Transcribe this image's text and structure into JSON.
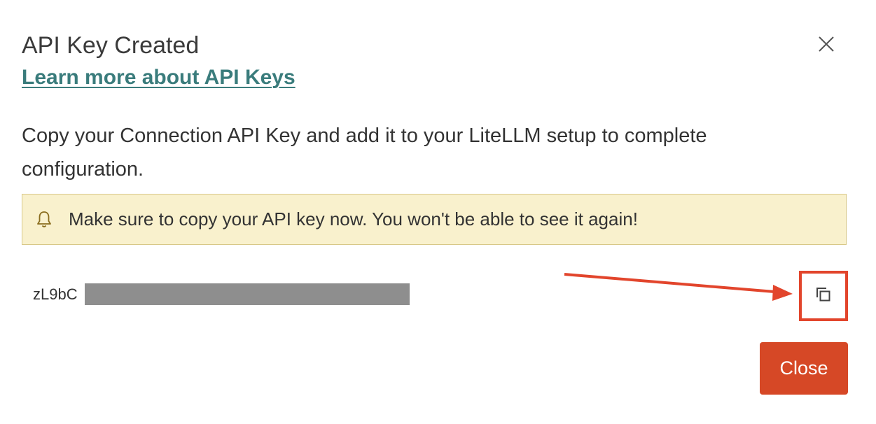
{
  "dialog": {
    "title": "API Key Created",
    "learn_more_link": "Learn more about API Keys",
    "description": "Copy your Connection API Key and add it to your LiteLLM setup to complete configuration.",
    "warning": {
      "icon": "bell-icon",
      "text": "Make sure to copy your API key now. You won't be able to see it again!"
    },
    "api_key": {
      "visible_prefix": "zL9bC",
      "copy_icon": "copy-icon"
    },
    "close_button_label": "Close",
    "close_icon": "close-icon"
  },
  "colors": {
    "link": "#3a7c7c",
    "warning_background": "#f9f1cd",
    "warning_border": "#d8c888",
    "primary_button": "#d64826",
    "annotation": "#e2452c",
    "redaction": "#8e8e8e"
  }
}
